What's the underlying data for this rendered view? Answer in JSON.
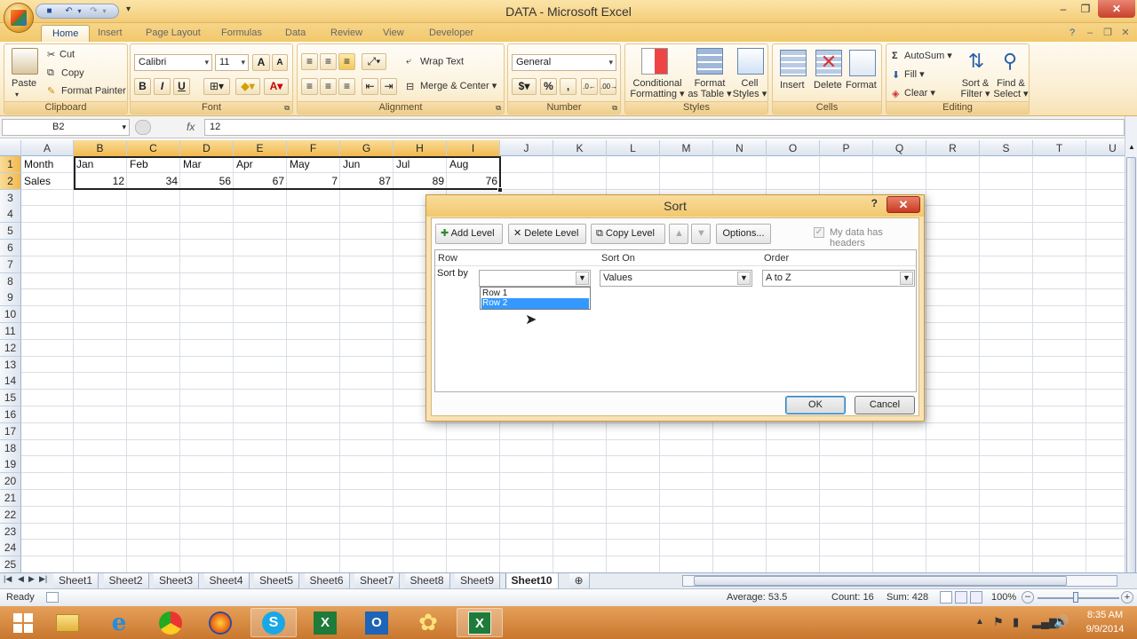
{
  "window": {
    "title": "DATA - Microsoft Excel"
  },
  "ribbon": {
    "tabs": [
      "Home",
      "Insert",
      "Page Layout",
      "Formulas",
      "Data",
      "Review",
      "View",
      "Developer"
    ],
    "active_tab": "Home",
    "clipboard": {
      "paste": "Paste",
      "cut": "Cut",
      "copy": "Copy",
      "format_painter": "Format Painter",
      "label": "Clipboard"
    },
    "font": {
      "name": "Calibri",
      "size": "11",
      "label": "Font",
      "bold": "B",
      "italic": "I",
      "underline": "U"
    },
    "alignment": {
      "wrap_text": "Wrap Text",
      "merge_center": "Merge & Center",
      "label": "Alignment"
    },
    "number": {
      "format": "General",
      "currency": "$",
      "percent": "%",
      "comma": ",",
      "label": "Number"
    },
    "styles": {
      "conditional_l1": "Conditional",
      "conditional_l2": "Formatting",
      "format_table_l1": "Format",
      "format_table_l2": "as Table",
      "cell_styles_l1": "Cell",
      "cell_styles_l2": "Styles",
      "label": "Styles"
    },
    "cells": {
      "insert": "Insert",
      "delete": "Delete",
      "format": "Format",
      "label": "Cells"
    },
    "editing": {
      "autosum": "AutoSum",
      "fill": "Fill",
      "clear": "Clear",
      "sort_l1": "Sort &",
      "sort_l2": "Filter",
      "find_l1": "Find &",
      "find_l2": "Select",
      "label": "Editing"
    }
  },
  "formula_bar": {
    "name_box": "B2",
    "fx": "fx",
    "value": "12"
  },
  "columns": [
    "A",
    "B",
    "C",
    "D",
    "E",
    "F",
    "G",
    "H",
    "I",
    "J",
    "K",
    "L",
    "M",
    "N",
    "O",
    "P",
    "Q",
    "R",
    "S",
    "T",
    "U"
  ],
  "rows": [
    "1",
    "2",
    "3",
    "4",
    "5",
    "6",
    "7",
    "8",
    "9",
    "10",
    "11",
    "12",
    "13",
    "14",
    "15",
    "16",
    "17",
    "18",
    "19",
    "20",
    "21",
    "22",
    "23",
    "24",
    "25"
  ],
  "cells": {
    "row1": [
      "Month",
      "Jan",
      "Feb",
      "Mar",
      "Apr",
      "May",
      "Jun",
      "Jul",
      "Aug"
    ],
    "row2": [
      "Sales",
      "12",
      "34",
      "56",
      "67",
      "7",
      "87",
      "89",
      "76"
    ]
  },
  "sheets": [
    "Sheet1",
    "Sheet2",
    "Sheet3",
    "Sheet4",
    "Sheet5",
    "Sheet6",
    "Sheet7",
    "Sheet8",
    "Sheet9",
    "Sheet10"
  ],
  "active_sheet": "Sheet10",
  "status": {
    "ready": "Ready",
    "average": "Average: 53.5",
    "count": "Count: 16",
    "sum": "Sum: 428",
    "zoom": "100%"
  },
  "dialog": {
    "title": "Sort",
    "help": "?",
    "add_level": "Add Level",
    "delete_level": "Delete Level",
    "copy_level": "Copy Level",
    "options": "Options...",
    "headers_checkbox": "My data has headers",
    "col_row": "Row",
    "col_sort_on": "Sort On",
    "col_order": "Order",
    "sort_by": "Sort by",
    "sort_by_value": "",
    "sort_on_value": "Values",
    "order_value": "A to Z",
    "dropdown_options": [
      "Row 1",
      "Row 2"
    ],
    "dropdown_highlighted": "Row 2",
    "ok": "OK",
    "cancel": "Cancel"
  },
  "taskbar": {
    "time": "8:35 AM",
    "date": "9/9/2014"
  },
  "colors": {
    "accent": "#f2c86a",
    "selection": "#3399ff",
    "header_select": "#f2b94e"
  }
}
